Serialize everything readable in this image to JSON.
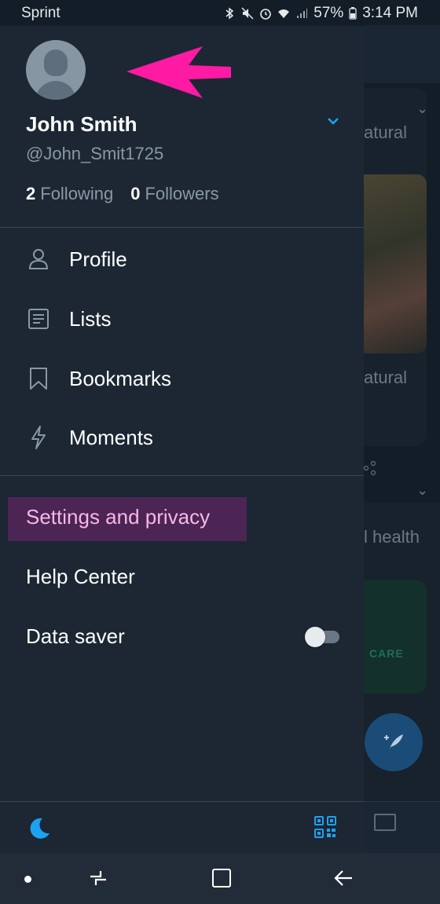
{
  "status_bar": {
    "carrier": "Sprint",
    "battery": "57%",
    "time": "3:14 PM",
    "icons": [
      "bluetooth-icon",
      "mute-icon",
      "alarm-icon",
      "wifi-icon",
      "signal-icon",
      "battery-icon"
    ]
  },
  "profile": {
    "name": "John Smith",
    "handle": "@John_Smit1725",
    "following_count": "2",
    "following_label": "Following",
    "followers_count": "0",
    "followers_label": "Followers"
  },
  "menu": {
    "items": [
      {
        "label": "Profile",
        "icon": "person-icon"
      },
      {
        "label": "Lists",
        "icon": "list-icon"
      },
      {
        "label": "Bookmarks",
        "icon": "bookmark-icon"
      },
      {
        "label": "Moments",
        "icon": "lightning-icon"
      }
    ]
  },
  "settings": {
    "settings_label": "Settings and privacy",
    "help_label": "Help Center",
    "data_saver_label": "Data saver",
    "data_saver_enabled": false
  },
  "background": {
    "text_1": "atural",
    "text_2": "atural",
    "text_3": "l health",
    "care_text": "CARE"
  },
  "colors": {
    "drawer_bg": "#1c2733",
    "accent": "#1da1f2",
    "highlight": "#4c2555",
    "arrow": "#ff1aa3"
  }
}
